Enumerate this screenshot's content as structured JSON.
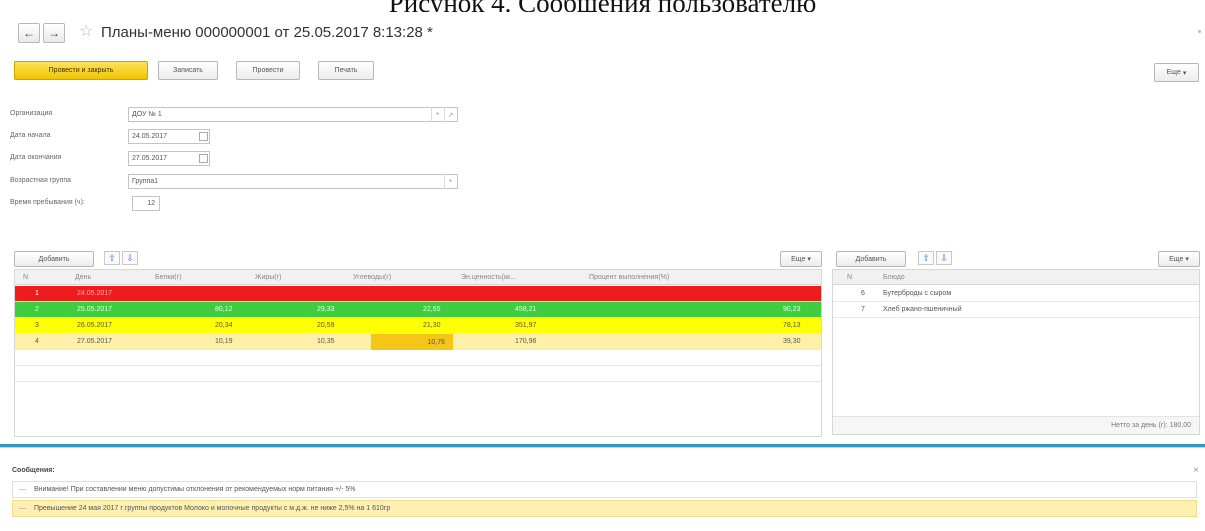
{
  "caption": "Рисунок 4. Сообщения пользователю",
  "window": {
    "title": "Планы-меню 000000001 от 25.05.2017 8:13:28 *",
    "back_icon": "arrow-left",
    "forward_icon": "arrow-right",
    "favorite_icon": "star"
  },
  "toolbar": {
    "post_and_close": "Провести и закрыть",
    "save": "Записать",
    "post": "Провести",
    "print": "Печать",
    "more": "Еще"
  },
  "form": {
    "org_label": "Организация",
    "org_value": "ДОУ № 1",
    "start_label": "Дата начала",
    "start_value": "24.05.2017",
    "end_label": "Дата окончания",
    "end_value": "27.05.2017",
    "age_label": "Возрастная группа",
    "age_value": "Группа1",
    "stay_label": "Время пребывания (ч):",
    "stay_value": "12"
  },
  "left_table": {
    "add_label": "Добавить",
    "more_label": "Еще",
    "headers": [
      "N",
      "День",
      "Белки(г)",
      "Жиры(г)",
      "Углеводы(г)",
      "Эн.ценность(кк...",
      "Процент выполнения(%)"
    ],
    "rows": [
      {
        "n": "1",
        "day": "24.05.2017",
        "protein": "",
        "fat": "",
        "carbs": "",
        "energy": "",
        "percent": ""
      },
      {
        "n": "2",
        "day": "25.05.2017",
        "protein": "80,12",
        "fat": "29,33",
        "carbs": "22,65",
        "energy": "458,21",
        "percent": "90,23"
      },
      {
        "n": "3",
        "day": "26.05.2017",
        "protein": "20,34",
        "fat": "20,59",
        "carbs": "21,30",
        "energy": "351,97",
        "percent": "78,13"
      },
      {
        "n": "4",
        "day": "27.05.2017",
        "protein": "10,19",
        "fat": "10,35",
        "carbs": "10,76",
        "energy": "170,96",
        "percent": "39,30"
      }
    ],
    "row_colors": [
      "#ee1c1c",
      "#3fcc3f",
      "#ffff00",
      "#fff0a8"
    ]
  },
  "right_table": {
    "add_label": "Добавить",
    "more_label": "Еще",
    "headers": [
      "N",
      "Блюдо"
    ],
    "rows": [
      {
        "n": "6",
        "dish": "Бутерброды с сыром"
      },
      {
        "n": "7",
        "dish": "Хлеб ржано-пшеничный"
      }
    ],
    "footer": "Нетто за день (г): 180,00"
  },
  "messages": {
    "title": "Сообщения:",
    "close": "×",
    "items": [
      "Внимание! При составлении меню допустимы отклонения от рекомендуемых норм питания +/- 5%",
      "Превышение 24 мая 2017 г группы продуктов Молоко и молочные продукты с м.д.ж. не ниже 2,5% на 1 610гр"
    ]
  }
}
